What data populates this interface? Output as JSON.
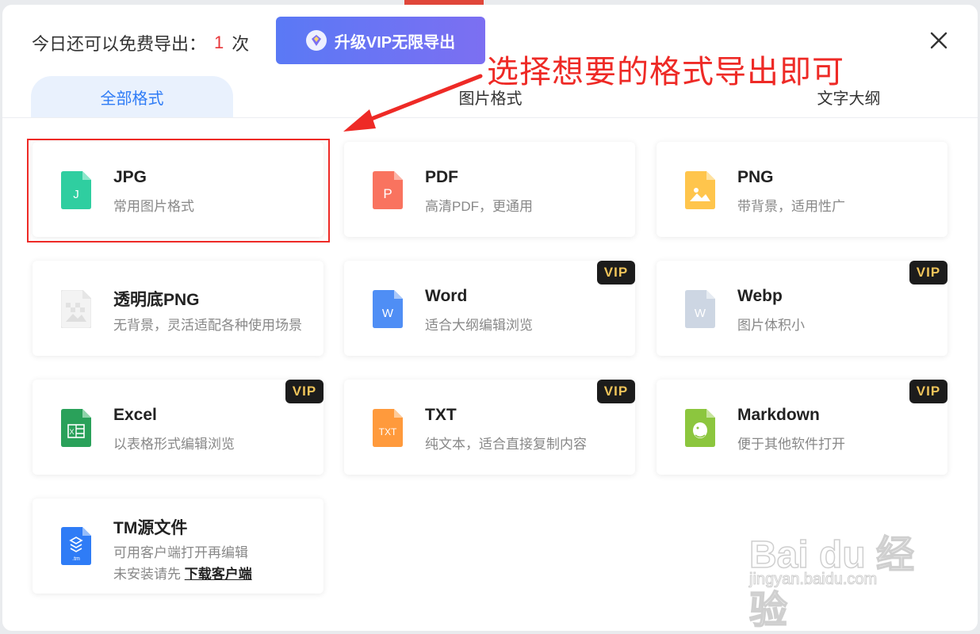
{
  "header": {
    "quota_prefix": "今日还可以免费导出：",
    "quota_count": "1",
    "quota_suffix": "次",
    "upgrade_label": "升级VIP无限导出",
    "close_icon": "close-icon"
  },
  "tabs": [
    {
      "label": "全部格式",
      "active": true
    },
    {
      "label": "图片格式",
      "active": false
    },
    {
      "label": "文字大纲",
      "active": false
    }
  ],
  "annotation": {
    "text": "选择想要的格式导出即可",
    "color": "#ee2a26"
  },
  "cards": [
    {
      "title": "JPG",
      "desc": "常用图片格式",
      "icon": "jpg-file-icon",
      "color": "#2fcea0",
      "vip": false
    },
    {
      "title": "PDF",
      "desc": "高清PDF，更通用",
      "icon": "pdf-file-icon",
      "color": "#f9735f",
      "vip": false
    },
    {
      "title": "PNG",
      "desc": "带背景，适用性广",
      "icon": "png-file-icon",
      "color": "#ffc54c",
      "vip": false
    },
    {
      "title": "透明底PNG",
      "desc": "无背景，灵活适配各种使用场景",
      "icon": "transparent-png-file-icon",
      "color": "#eeeeee",
      "vip": false
    },
    {
      "title": "Word",
      "desc": "适合大纲编辑浏览",
      "icon": "word-file-icon",
      "color": "#4f8ef5",
      "vip": true
    },
    {
      "title": "Webp",
      "desc": "图片体积小",
      "icon": "webp-file-icon",
      "color": "#cdd6e3",
      "vip": true
    },
    {
      "title": "Excel",
      "desc": "以表格形式编辑浏览",
      "icon": "excel-file-icon",
      "color": "#2aa15a",
      "vip": true
    },
    {
      "title": "TXT",
      "desc": "纯文本，适合直接复制内容",
      "icon": "txt-file-icon",
      "color": "#ff9a3c",
      "vip": true
    },
    {
      "title": "Markdown",
      "desc": "便于其他软件打开",
      "icon": "markdown-file-icon",
      "color": "#8cc63e",
      "vip": true
    },
    {
      "title": "TM源文件",
      "desc": "可用客户端打开再编辑",
      "desc2_prefix": "未安装请先",
      "desc2_link": "下载客户端",
      "icon": "tm-file-icon",
      "color": "#2f7cf6",
      "vip": false
    }
  ],
  "vip_label": "VIP",
  "watermark": {
    "text": "Bai du 经验",
    "url": "jingyan.baidu.com"
  }
}
